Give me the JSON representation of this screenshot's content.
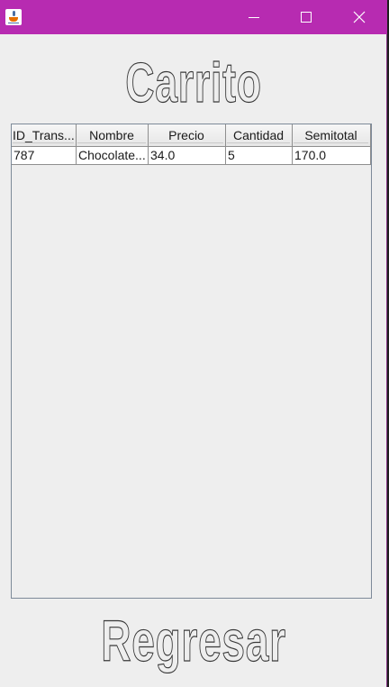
{
  "window": {
    "icon": "java-icon"
  },
  "title": "Carrito",
  "table": {
    "columns": [
      "ID_Trans...",
      "Nombre",
      "Precio",
      "Cantidad",
      "Semitotal"
    ],
    "rows": [
      [
        "787",
        "Chocolate...",
        "34.0",
        "5",
        "170.0"
      ]
    ]
  },
  "back_button_label": "Regresar"
}
